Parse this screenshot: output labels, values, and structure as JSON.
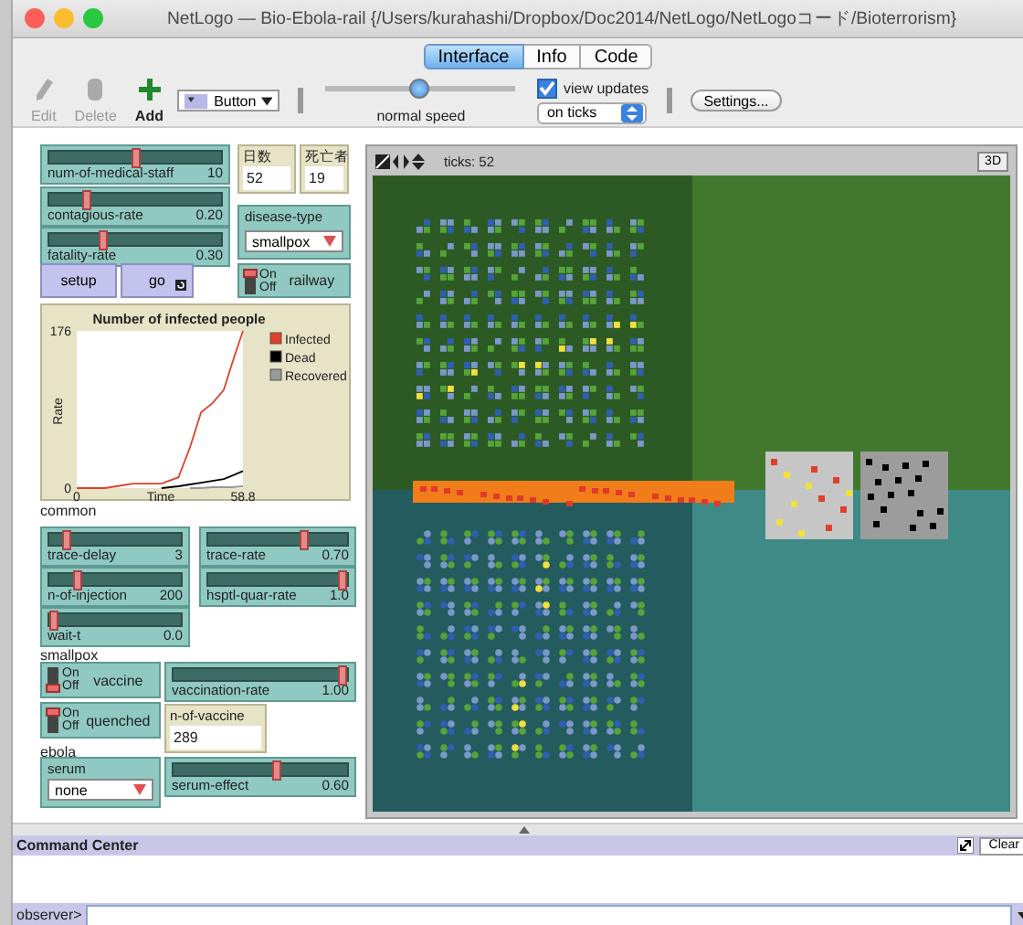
{
  "window": {
    "title": "NetLogo — Bio-Ebola-rail {/Users/kurahashi/Dropbox/Doc2014/NetLogo/NetLogoコード/Bioterrorism}"
  },
  "tabs": [
    {
      "label": "Interface",
      "selected": true
    },
    {
      "label": "Info",
      "selected": false
    },
    {
      "label": "Code",
      "selected": false
    }
  ],
  "toolbar": {
    "tools": [
      {
        "label": "Edit",
        "kind": "edit",
        "disabled": true
      },
      {
        "label": "Delete",
        "kind": "delete",
        "disabled": true
      },
      {
        "label": "Add",
        "kind": "add",
        "disabled": false
      }
    ],
    "widget_type": "Button",
    "speed": {
      "label": "normal speed",
      "level": 0.5
    },
    "view_updates": {
      "label": "view updates",
      "checked": true
    },
    "update_mode": "on ticks",
    "settings": "Settings..."
  },
  "widgets": [
    {
      "kind": "slider",
      "label": "num-of-medical-staff",
      "value": "10",
      "level": 0.5
    },
    {
      "kind": "slider",
      "label": "contagious-rate",
      "value": "0.20",
      "level": 0.2
    },
    {
      "kind": "slider",
      "label": "fatality-rate",
      "value": "0.30",
      "level": 0.3
    },
    {
      "kind": "monitor",
      "label": "日数",
      "value": "52"
    },
    {
      "kind": "monitor",
      "label": "死亡者",
      "value": "19"
    },
    {
      "kind": "chooser",
      "label": "disease-type",
      "value": "smallpox"
    },
    {
      "kind": "button",
      "label": "setup",
      "forever": false
    },
    {
      "kind": "button",
      "label": "go",
      "forever": true
    },
    {
      "kind": "switch",
      "label": "railway",
      "on": true,
      "on_label": "On",
      "off_label": "Off"
    },
    {
      "kind": "plot",
      "chart_data": {
        "type": "line",
        "title": "Number of infected people",
        "xlabel": "Time",
        "ylabel": "Rate",
        "x": [
          0,
          10,
          16,
          20,
          30,
          36,
          40,
          44,
          48,
          52,
          55,
          58.8
        ],
        "legend": "right",
        "xlim": [
          0,
          58.8
        ],
        "ylim": [
          0,
          176
        ],
        "xticks": [
          0,
          58.8
        ],
        "yticks": [
          0,
          176
        ],
        "series": [
          {
            "name": "Infected",
            "color": "#e0402a",
            "values": [
              0,
              0,
              3,
              5,
              5,
              12,
              45,
              85,
              95,
              110,
              140,
              176
            ]
          },
          {
            "name": "Dead",
            "color": "#000000",
            "values": [
              null,
              null,
              null,
              null,
              0,
              2,
              4,
              6,
              8,
              10,
              14,
              19
            ]
          },
          {
            "name": "Recovered",
            "color": "#999999",
            "values": [
              null,
              null,
              null,
              null,
              null,
              null,
              0,
              0,
              1,
              1,
              1,
              2
            ]
          }
        ]
      }
    },
    {
      "kind": "note",
      "text": "common"
    },
    {
      "kind": "slider",
      "label": "trace-delay",
      "value": "3",
      "level": 0.1
    },
    {
      "kind": "slider",
      "label": "trace-rate",
      "value": "0.70",
      "level": 0.7
    },
    {
      "kind": "slider",
      "label": "n-of-injection",
      "value": "200",
      "level": 0.2
    },
    {
      "kind": "slider",
      "label": "hsptl-quar-rate",
      "value": "1.0",
      "level": 1
    },
    {
      "kind": "slider",
      "label": "wait-t",
      "value": "0.0",
      "level": 0
    },
    {
      "kind": "note",
      "text": "smallpox"
    },
    {
      "kind": "switch",
      "label": "vaccine",
      "on": false,
      "on_label": "On",
      "off_label": "Off"
    },
    {
      "kind": "slider",
      "label": "vaccination-rate",
      "value": "1.00",
      "level": 1
    },
    {
      "kind": "switch",
      "label": "quenched",
      "on": true,
      "on_label": "On",
      "off_label": "Off"
    },
    {
      "kind": "monitor",
      "label": "n-of-vaccine",
      "value": "289"
    },
    {
      "kind": "note",
      "text": "ebola"
    },
    {
      "kind": "chooser",
      "label": "serum",
      "value": "none"
    },
    {
      "kind": "slider",
      "label": "serum-effect",
      "value": "0.60",
      "level": 0.6
    }
  ],
  "view": {
    "ticks": "ticks: 52",
    "three_d": "3D"
  },
  "command_center": {
    "title": "Command Center",
    "clear": "Clear",
    "prompt": "observer>"
  }
}
